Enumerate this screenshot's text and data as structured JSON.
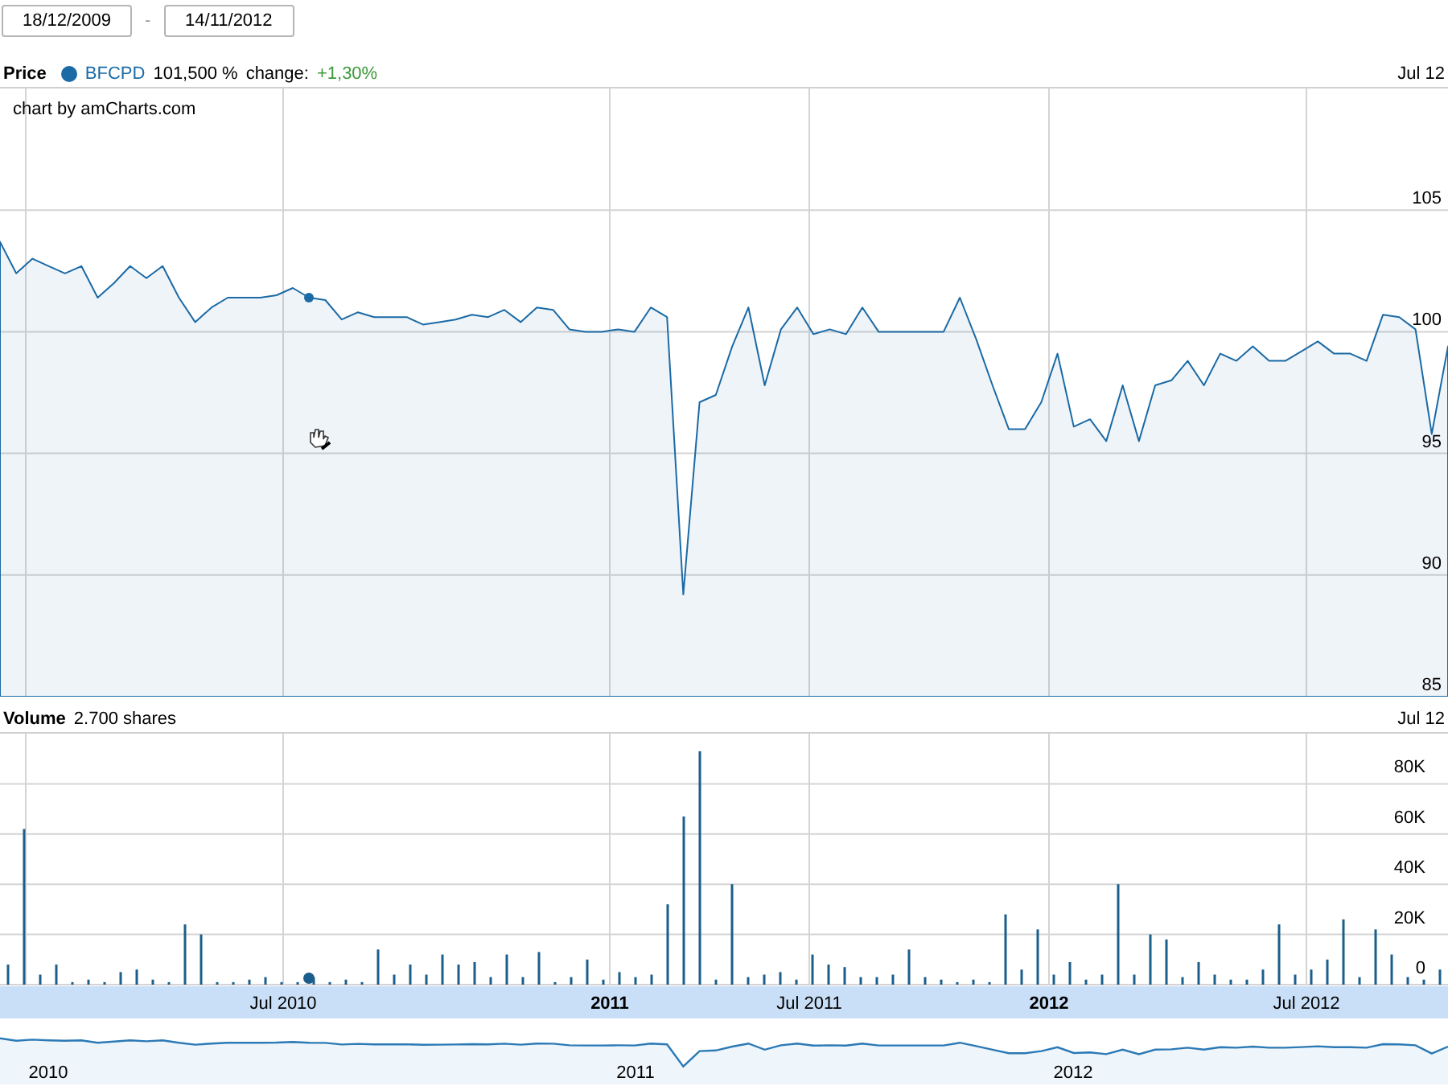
{
  "date_range": {
    "start": "18/12/2009",
    "separator": "-",
    "end": "14/11/2012"
  },
  "price_panel": {
    "title": "Price",
    "value": "101,500 %",
    "change_label": "change:",
    "change_value": "+1,30%",
    "date": "Jul 12",
    "credit": "chart by amCharts.com",
    "chart_data": {
      "type": "area",
      "ylim": [
        85,
        110
      ],
      "yticks": [
        85,
        90,
        95,
        100,
        105
      ],
      "grid": true,
      "series": [
        {
          "name": "BFCPD",
          "color": "#1b6aa5",
          "values": [
            103.7,
            102.4,
            103,
            102.7,
            102.4,
            102.7,
            101.4,
            102,
            102.7,
            102.2,
            102.7,
            101.4,
            100.4,
            101,
            101.4,
            101.4,
            101.4,
            101.5,
            101.8,
            101.4,
            101.3,
            100.5,
            100.8,
            100.6,
            100.6,
            100.6,
            100.3,
            100.4,
            100.5,
            100.7,
            100.6,
            100.9,
            100.4,
            101,
            100.9,
            100.1,
            100,
            100,
            100.1,
            100,
            101,
            100.6,
            89.2,
            97.1,
            97.4,
            99.4,
            101,
            97.8,
            100.1,
            101,
            99.9,
            100.1,
            99.9,
            101,
            100,
            100,
            100,
            100,
            100,
            101.4,
            99.7,
            97.8,
            96,
            96,
            97.1,
            99.1,
            96.1,
            96.4,
            95.5,
            97.8,
            95.5,
            97.8,
            98,
            98.8,
            97.8,
            99.1,
            98.8,
            99.4,
            98.8,
            98.8,
            99.2,
            99.6,
            99.1,
            99.1,
            98.8,
            100.7,
            100.6,
            100.1,
            95.8,
            99.4
          ]
        }
      ]
    }
  },
  "volume_panel": {
    "title": "Volume",
    "value": "2.700 shares",
    "date": "Jul 12",
    "chart_data": {
      "type": "bar",
      "ylim": [
        0,
        100000
      ],
      "yticks": [
        {
          "value": 0,
          "label": "0"
        },
        {
          "value": 20000,
          "label": "20K"
        },
        {
          "value": 40000,
          "label": "40K"
        },
        {
          "value": 60000,
          "label": "60K"
        },
        {
          "value": 80000,
          "label": "80K"
        }
      ],
      "grid": true,
      "series": [
        {
          "color": "#1b5e8c",
          "values": [
            8000,
            62000,
            4000,
            8000,
            1000,
            2000,
            1000,
            5000,
            6000,
            2000,
            1000,
            24000,
            20000,
            1000,
            1000,
            2000,
            3000,
            1000,
            1000,
            3000,
            1000,
            2000,
            1000,
            14000,
            4000,
            8000,
            4000,
            12000,
            8000,
            9000,
            3000,
            12000,
            3000,
            13000,
            1000,
            3000,
            10000,
            2000,
            5000,
            3000,
            4000,
            32000,
            67000,
            93000,
            2000,
            40000,
            3000,
            4000,
            5000,
            2000,
            12000,
            8000,
            7000,
            3000,
            3000,
            4000,
            14000,
            3000,
            2000,
            1000,
            2000,
            1000,
            28000,
            6000,
            22000,
            4000,
            9000,
            2000,
            4000,
            40000,
            4000,
            20000,
            18000,
            3000,
            9000,
            4000,
            2000,
            2000,
            6000,
            24000,
            4000,
            6000,
            10000,
            26000,
            3000,
            22000,
            12000,
            3000,
            2000,
            6000
          ]
        }
      ]
    },
    "date_axis": [
      {
        "label": "Jul 2010",
        "major": false
      },
      {
        "label": "2011",
        "major": true
      },
      {
        "label": "Jul 2011",
        "major": false
      },
      {
        "label": "2012",
        "major": true
      },
      {
        "label": "Jul 2012",
        "major": false
      }
    ]
  },
  "navigator": {
    "labels": [
      "2010",
      "2011",
      "2012"
    ]
  }
}
